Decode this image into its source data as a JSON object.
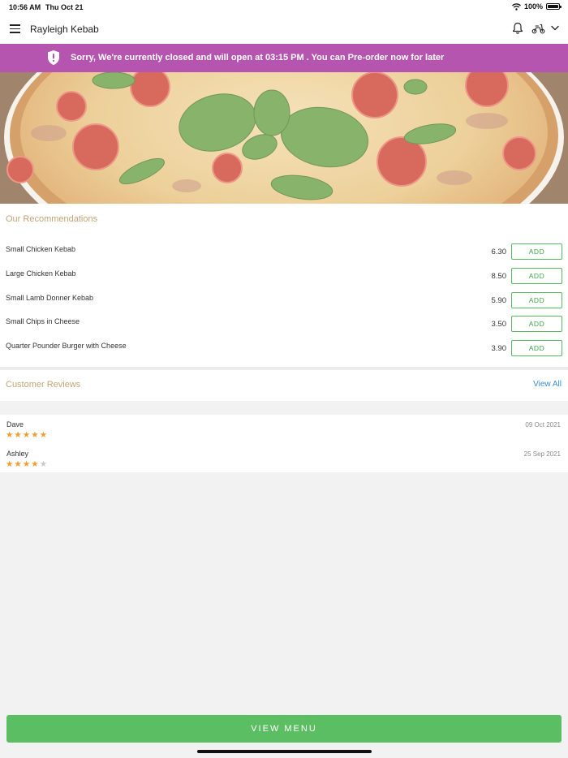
{
  "status_bar": {
    "time": "10:56 AM",
    "date": "Thu Oct 21",
    "battery": "100%",
    "battery_level": 1.0
  },
  "header": {
    "title": "Rayleigh Kebab",
    "icons": [
      "menu-icon",
      "bell-icon",
      "scooter-icon",
      "chevron-down-icon"
    ]
  },
  "banner": {
    "message": "Sorry, We're currently closed and will open at 03:15 PM . You can Pre-order now for later",
    "icon": "shield-alert-icon",
    "color": "#b655b0"
  },
  "recommendations": {
    "title": "Our Recommendations",
    "items": [
      {
        "name": "Small Chicken Kebab",
        "price": "6.30",
        "button": "ADD"
      },
      {
        "name": "Large Chicken Kebab",
        "price": "8.50",
        "button": "ADD"
      },
      {
        "name": "Small Lamb Donner Kebab",
        "price": "5.90",
        "button": "ADD"
      },
      {
        "name": "Small Chips in Cheese",
        "price": "3.50",
        "button": "ADD"
      },
      {
        "name": "Quarter Pounder Burger with Cheese",
        "price": "3.90",
        "button": "ADD"
      }
    ]
  },
  "reviews": {
    "title": "Customer Reviews",
    "view_all": "View All",
    "items": [
      {
        "name": "Dave",
        "date": "09 Oct 2021",
        "rating": 5,
        "max_rating": 5
      },
      {
        "name": "Ashley",
        "date": "25 Sep 2021",
        "rating": 4,
        "max_rating": 5
      }
    ]
  },
  "footer": {
    "button": "VIEW MENU",
    "color": "#5cbe63"
  },
  "colors": {
    "accent_title": "#c2a478",
    "link": "#3b8ccf",
    "add_button": "#57b95f",
    "star": "#f29c2e"
  }
}
